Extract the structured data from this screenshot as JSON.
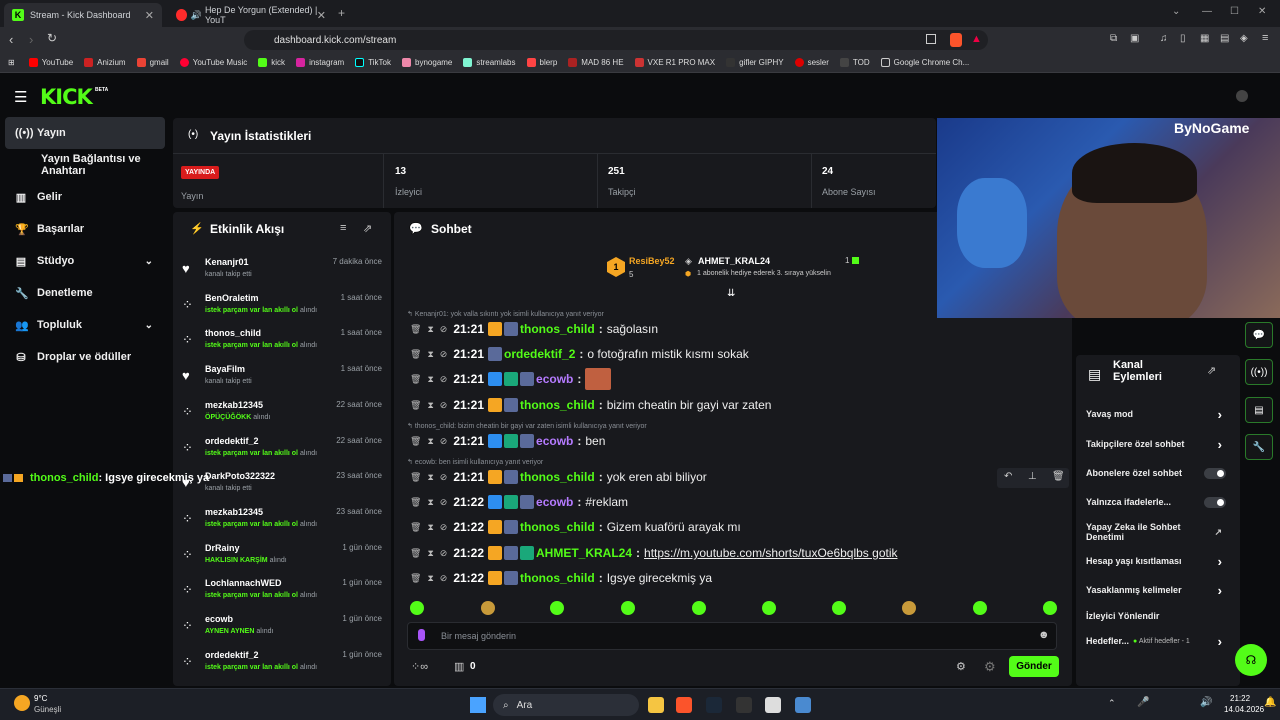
{
  "browser": {
    "tabs": [
      {
        "title": "Stream - Kick Dashboard"
      },
      {
        "title": "Hep De Yorgun (Extended) | YouT"
      }
    ],
    "url": "dashboard.kick.com/stream",
    "bookmarks": [
      "YouTube",
      "Anizium",
      "gmail",
      "YouTube Music",
      "kick",
      "instagram",
      "TikTok",
      "bynogame",
      "streamlabs",
      "blerp",
      "MAD 86 HE",
      "VXE R1 PRO MAX",
      "gifler GIPHY",
      "sesler",
      "TOD",
      "Google Chrome Ch..."
    ]
  },
  "logo": "KICK",
  "logo_beta": "BETA",
  "sidebar": {
    "items": [
      {
        "label": "Yayın",
        "icon": "broadcast-icon"
      },
      {
        "label": "Yayın Bağlantısı ve Anahtarı",
        "icon": ""
      },
      {
        "label": "Gelir",
        "icon": "revenue-icon"
      },
      {
        "label": "Başarılar",
        "icon": "trophy-icon"
      },
      {
        "label": "Stüdyo",
        "icon": "studio-icon"
      },
      {
        "label": "Denetleme",
        "icon": "wrench-icon"
      },
      {
        "label": "Topluluk",
        "icon": "community-icon"
      },
      {
        "label": "Droplar ve ödüller",
        "icon": "drops-icon"
      }
    ]
  },
  "stats": {
    "title": "Yayın İstatistikleri",
    "live_badge": "YAYINDA",
    "live_label": "Yayın",
    "viewers": {
      "value": "13",
      "label": "İzleyici"
    },
    "followers": {
      "value": "251",
      "label": "Takipçi"
    },
    "subs": {
      "value": "24",
      "label": "Abone Sayısı"
    }
  },
  "activity": {
    "title": "Etkinlik Akışı",
    "items": [
      {
        "name": "Kenanjr01",
        "time": "7 dakika önce",
        "sub": "kanalı takip etti",
        "highlight": "",
        "icon": "heart"
      },
      {
        "name": "BenOraletim",
        "time": "1 saat önce",
        "sub": "alındı",
        "highlight": "istek parçam var lan akıllı ol",
        "icon": "gift"
      },
      {
        "name": "thonos_child",
        "time": "1 saat önce",
        "sub": "alındı",
        "highlight": "istek parçam var lan akıllı ol",
        "icon": "gift"
      },
      {
        "name": "BayaFilm",
        "time": "1 saat önce",
        "sub": "kanalı takip etti",
        "highlight": "",
        "icon": "heart"
      },
      {
        "name": "mezkab12345",
        "time": "22 saat önce",
        "sub": "alındı",
        "highlight": "ÖPÜÇÜĞÖKK",
        "icon": "gift"
      },
      {
        "name": "ordedektif_2",
        "time": "22 saat önce",
        "sub": "alındı",
        "highlight": "istek parçam var lan akıllı ol",
        "icon": "gift"
      },
      {
        "name": "DarkPoto322322",
        "time": "23 saat önce",
        "sub": "kanalı takip etti",
        "highlight": "",
        "icon": "heart"
      },
      {
        "name": "mezkab12345",
        "time": "23 saat önce",
        "sub": "alındı",
        "highlight": "istek parçam var lan akıllı ol",
        "icon": "gift"
      },
      {
        "name": "DrRainy",
        "time": "1 gün önce",
        "sub": "alındı",
        "highlight": "HAKLISIN KARŞİM",
        "icon": "gift"
      },
      {
        "name": "LochlannachWED",
        "time": "1 gün önce",
        "sub": "alındı",
        "highlight": "istek parçam var lan akıllı ol",
        "icon": "gift"
      },
      {
        "name": "ecowb",
        "time": "1 gün önce",
        "sub": "alındı",
        "highlight": "AYNEN AYNEN",
        "icon": "gift"
      },
      {
        "name": "ordedektif_2",
        "time": "1 gün önce",
        "sub": "alındı",
        "highlight": "istek parçam var lan akıllı ol",
        "icon": "gift"
      }
    ]
  },
  "chat": {
    "title": "Sohbet",
    "pinned": {
      "user1": "ResiBey52",
      "user1_count": "5",
      "user2": "AHMET_KRAL24",
      "user2_count": "1",
      "note": "1 abonelik hediye ederek 3. sıraya yükselin"
    },
    "messages": [
      {
        "reply": "Kenanjr01: yok valla sıkıntı yok isimli kullanıcıya yanıt veriyor",
        "time": "21:21",
        "user": "thonos_child",
        "color": "#53fc18",
        "text": "sağolasın",
        "badges": [
          "b-crown",
          "b-av"
        ]
      },
      {
        "reply": "",
        "time": "21:21",
        "user": "ordedektif_2",
        "color": "#53fc18",
        "text": "o fotoğrafın mistik kısmı sokak",
        "badges": [
          "b-av"
        ]
      },
      {
        "reply": "",
        "time": "21:21",
        "user": "ecowb",
        "color": "#b57bff",
        "text": "",
        "badges": [
          "b-blue",
          "b-green",
          "b-av"
        ]
      },
      {
        "reply": "",
        "time": "21:21",
        "user": "thonos_child",
        "color": "#53fc18",
        "text": "bizim cheatin bir gayi var zaten",
        "badges": [
          "b-crown",
          "b-av"
        ]
      },
      {
        "reply": "thonos_child: bizim cheatin bir gayi var zaten isimli kullanıcıya yanıt veriyor",
        "time": "21:21",
        "user": "ecowb",
        "color": "#b57bff",
        "text": "ben",
        "badges": [
          "b-blue",
          "b-green",
          "b-av"
        ]
      },
      {
        "reply": "ecowb: ben isimli kullanıcıya yanıt veriyor",
        "time": "21:21",
        "user": "thonos_child",
        "color": "#53fc18",
        "text": "yok eren abi biliyor",
        "badges": [
          "b-crown",
          "b-av"
        ]
      },
      {
        "reply": "",
        "time": "21:22",
        "user": "ecowb",
        "color": "#b57bff",
        "text": "#reklam",
        "badges": [
          "b-blue",
          "b-green",
          "b-av"
        ]
      },
      {
        "reply": "",
        "time": "21:22",
        "user": "thonos_child",
        "color": "#53fc18",
        "text": "Gizem kuaförü arayak mı",
        "badges": [
          "b-crown",
          "b-av"
        ]
      },
      {
        "reply": "",
        "time": "21:22",
        "user": "AHMET_KRAL24",
        "color": "#53fc18",
        "text": "https://m.youtube.com/shorts/tuxOe6bqlbs gotik",
        "badges": [
          "b-crown",
          "b-av",
          "b-green"
        ]
      },
      {
        "reply": "",
        "time": "21:22",
        "user": "thonos_child",
        "color": "#53fc18",
        "text": "Igsye girecekmiş ya",
        "badges": [
          "b-crown",
          "b-av"
        ]
      }
    ],
    "input_placeholder": "Bir mesaj gönderin",
    "points": "0",
    "send": "Gönder"
  },
  "overlay_chat": {
    "user": "thonos_child",
    "text": ": Igsye girecekmiş ya"
  },
  "webcam": {
    "brand": "ByNoGame"
  },
  "channel_actions": {
    "title": "Kanal Eylemleri",
    "items": [
      {
        "label": "Yavaş mod",
        "control": "chevron"
      },
      {
        "label": "Takipçilere özel sohbet",
        "control": "chevron"
      },
      {
        "label": "Abonelere özel sohbet",
        "control": "toggle"
      },
      {
        "label": "Yalnızca ifadelerle...",
        "control": "toggle"
      },
      {
        "label": "Yapay Zeka ile Sohbet Denetimi",
        "control": "link"
      },
      {
        "label": "Hesap yaşı kısıtlaması",
        "control": "chevron"
      },
      {
        "label": "Yasaklanmış kelimeler",
        "control": "chevron"
      },
      {
        "label": "İzleyici Yönlendir",
        "control": ""
      },
      {
        "label": "Hedefler...",
        "control": "chevron",
        "extra": "Aktif hedefler - 1"
      }
    ]
  },
  "taskbar": {
    "weather_temp": "9°C",
    "weather_label": "Güneşli",
    "search": "Ara",
    "time": "21:22",
    "date": "14.04.2026"
  }
}
